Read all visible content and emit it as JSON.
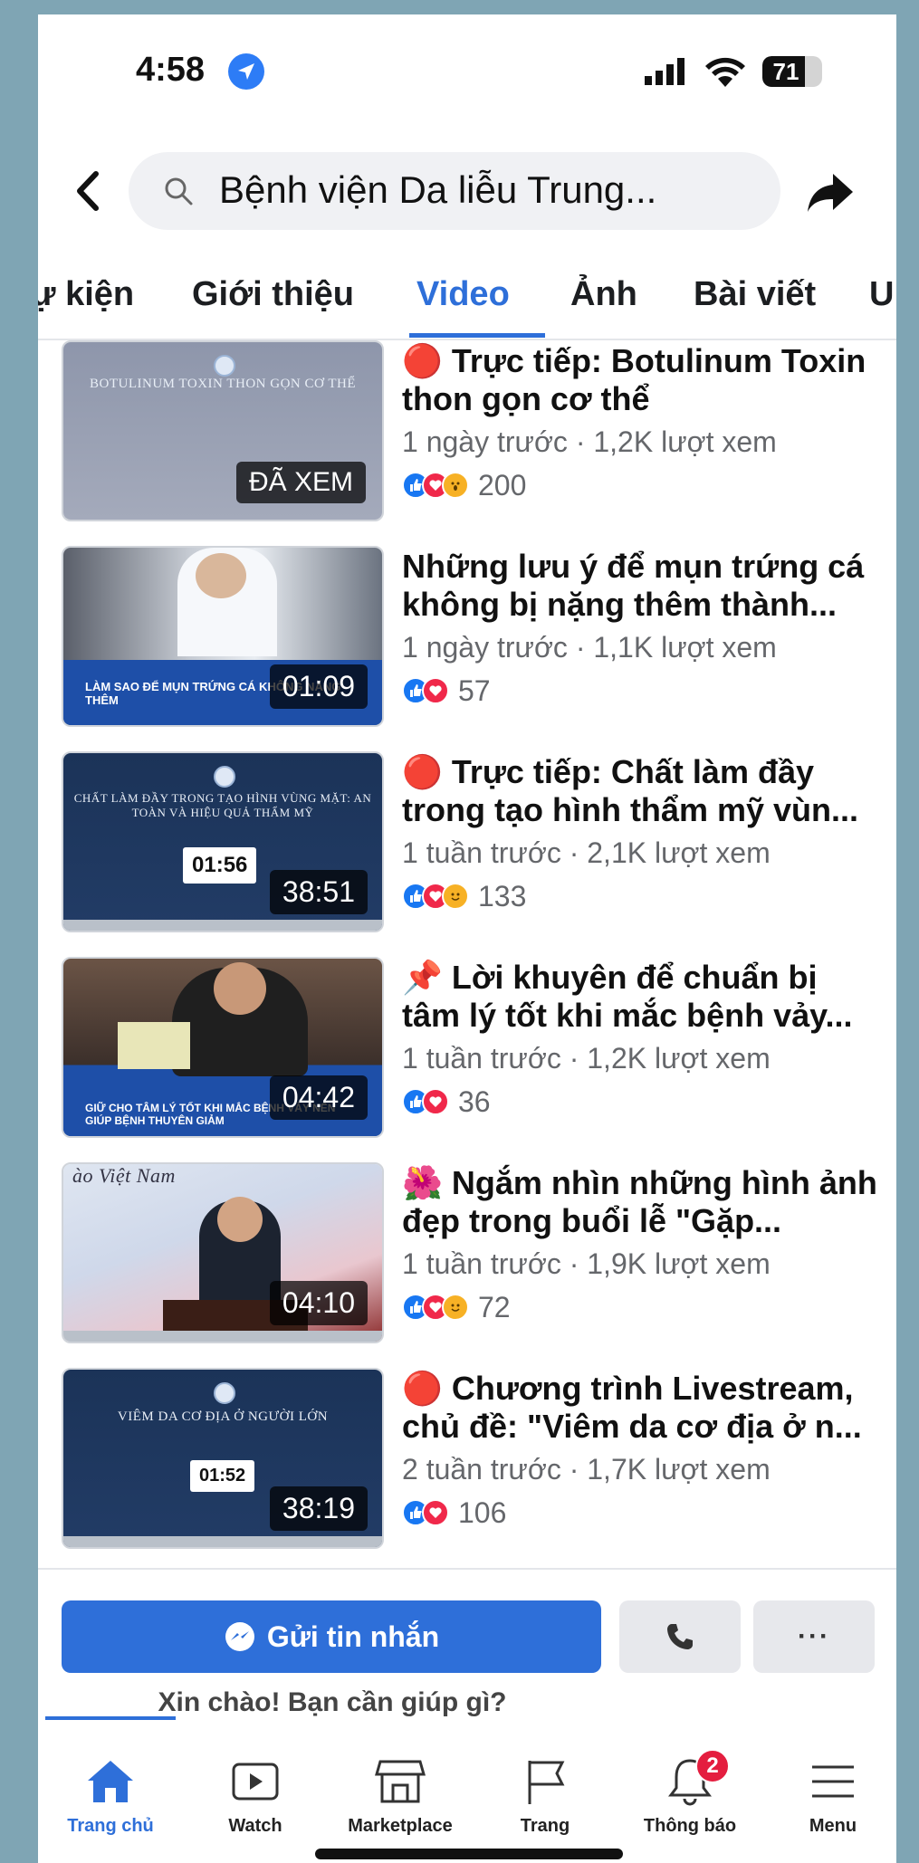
{
  "status_bar": {
    "time": "4:58",
    "battery": "71",
    "battery_level": 0.71
  },
  "search": {
    "query": "Bệnh viện Da liễu Trung..."
  },
  "tabs": [
    {
      "label": "ự kiện"
    },
    {
      "label": "Giới thiệu"
    },
    {
      "label": "Video",
      "active": true
    },
    {
      "label": "Ảnh"
    },
    {
      "label": "Bài viết"
    },
    {
      "label": "U"
    }
  ],
  "videos": [
    {
      "title": "🔴 Trực tiếp: Botulinum Toxin thon gọn cơ thể",
      "meta": "1 ngày trước · 1,2K lượt xem",
      "reactions": [
        "like",
        "love",
        "wow"
      ],
      "count": "200",
      "thumb_caption": "BOTULINUM TOXIN THON GỌN CƠ THỂ",
      "overlay": "ĐÃ XEM"
    },
    {
      "title": "Những lưu ý để mụn trứng cá không bị nặng thêm thành...",
      "meta": "1 ngày trước · 1,1K lượt xem",
      "reactions": [
        "like",
        "love"
      ],
      "count": "57",
      "thumb_caption": "LÀM SAO ĐỂ MỤN TRỨNG CÁ KHÔNG NẶNG THÊM",
      "overlay": "01:09"
    },
    {
      "title": "🔴 Trực tiếp: Chất làm đầy trong tạo hình thẩm mỹ vùn...",
      "meta": "1 tuần trước · 2,1K lượt xem",
      "reactions": [
        "like",
        "love",
        "care"
      ],
      "count": "133",
      "thumb_caption": "CHẤT LÀM ĐẦY TRONG TẠO HÌNH VÙNG MẶT: AN TOÀN VÀ HIỆU QUẢ THẨM MỸ",
      "inner": "01:56",
      "overlay": "38:51"
    },
    {
      "title": "📌 Lời khuyên để chuẩn bị tâm lý tốt khi mắc bệnh vảy...",
      "meta": "1 tuần trước · 1,2K lượt xem",
      "reactions": [
        "like",
        "love"
      ],
      "count": "36",
      "thumb_caption": "GIỮ CHO TÂM LÝ TỐT KHI MẮC BỆNH VẢY NẾN GIÚP BỆNH THUYÊN GIẢM",
      "overlay": "04:42"
    },
    {
      "title": "🌺 Ngắm nhìn những hình ảnh đẹp trong buổi lễ \"Gặp...",
      "meta": "1 tuần trước · 1,9K lượt xem",
      "reactions": [
        "like",
        "love",
        "care"
      ],
      "count": "72",
      "thumb_caption": "ào Việt Nam",
      "overlay": "04:10"
    },
    {
      "title": "🔴 Chương trình Livestream, chủ đề: \"Viêm da cơ địa ở n...",
      "meta": "2 tuần trước · 1,7K lượt xem",
      "reactions": [
        "like",
        "love"
      ],
      "count": "106",
      "thumb_caption": "VIÊM DA CƠ ĐỊA Ở NGƯỜI LỚN",
      "inner": "01:52",
      "overlay": "38:19"
    }
  ],
  "actions": {
    "message_label": "Gửi tin nhắn",
    "more_label": "···",
    "greeting": "Xin chào! Bạn cần giúp gì?"
  },
  "nav": [
    {
      "label": "Trang chủ",
      "icon": "home-icon",
      "active": true
    },
    {
      "label": "Watch",
      "icon": "watch-icon"
    },
    {
      "label": "Marketplace",
      "icon": "marketplace-icon"
    },
    {
      "label": "Trang",
      "icon": "flag-icon"
    },
    {
      "label": "Thông báo",
      "icon": "bell-icon",
      "badge": "2"
    },
    {
      "label": "Menu",
      "icon": "menu-icon"
    }
  ],
  "colors": {
    "accent": "#2e6fd9",
    "background": "#7fa5b4"
  }
}
